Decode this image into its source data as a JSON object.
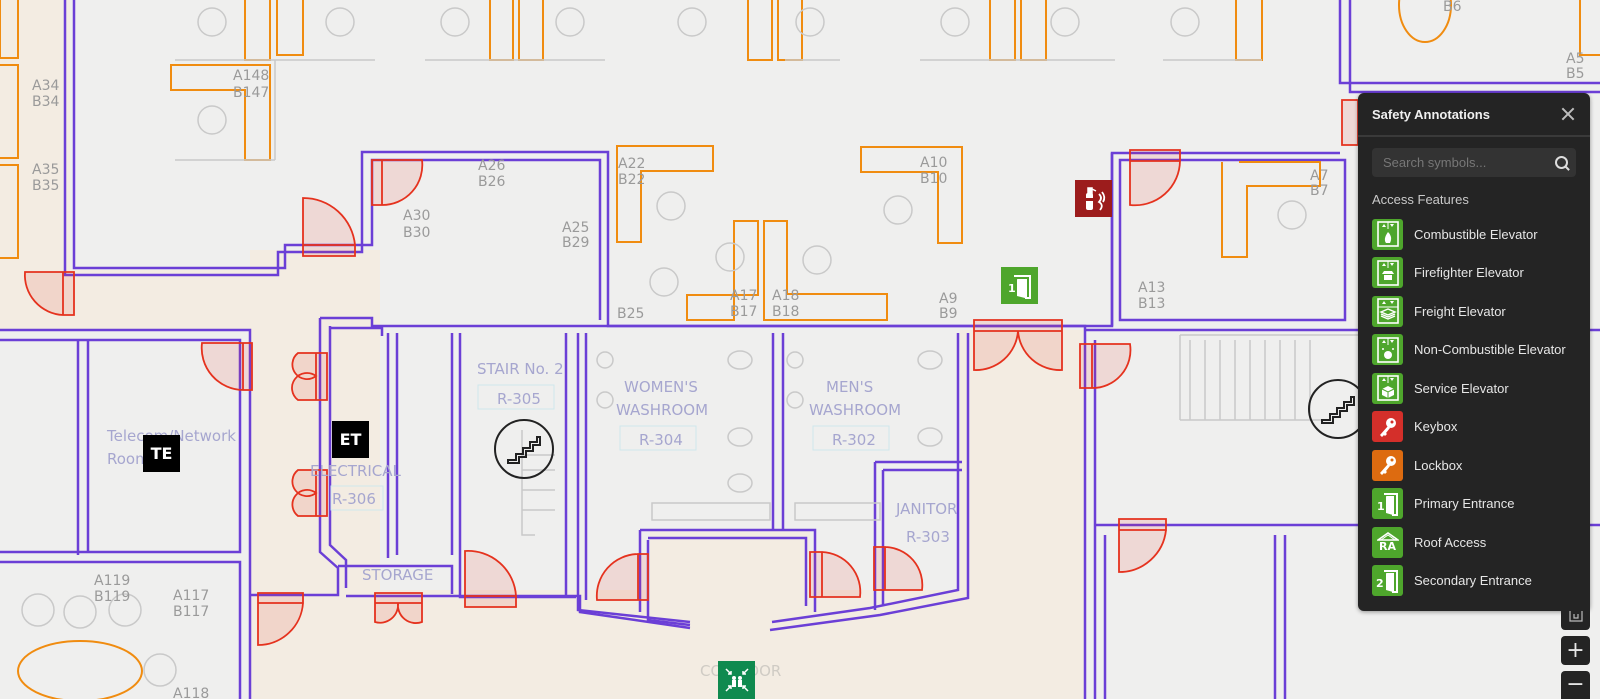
{
  "floor_plan": {
    "room_labels": [
      {
        "id": "a148",
        "lines": [
          "A148",
          "B147"
        ]
      },
      {
        "id": "a34",
        "lines": [
          "A34",
          "B34"
        ]
      },
      {
        "id": "a35",
        "lines": [
          "A35",
          "B35"
        ]
      },
      {
        "id": "a26",
        "lines": [
          "A26",
          "B26"
        ]
      },
      {
        "id": "a30",
        "lines": [
          "A30",
          "B30"
        ]
      },
      {
        "id": "a25",
        "lines": [
          "A25",
          "B29"
        ]
      },
      {
        "id": "a22",
        "lines": [
          "A22",
          "B22"
        ]
      },
      {
        "id": "a10",
        "lines": [
          "A10",
          "B10"
        ]
      },
      {
        "id": "a17",
        "lines": [
          "A17",
          "B17"
        ]
      },
      {
        "id": "a18",
        "lines": [
          "A18",
          "B18"
        ]
      },
      {
        "id": "b25",
        "lines": [
          "B25"
        ]
      },
      {
        "id": "a9",
        "lines": [
          "A9",
          "B9"
        ]
      },
      {
        "id": "a7",
        "lines": [
          "A7",
          "B7"
        ]
      },
      {
        "id": "a13",
        "lines": [
          "A13",
          "B13"
        ]
      },
      {
        "id": "b6",
        "lines": [
          "B6"
        ]
      },
      {
        "id": "a5",
        "lines": [
          "A5",
          "B5"
        ]
      },
      {
        "id": "a119",
        "lines": [
          "A119",
          "B119"
        ]
      },
      {
        "id": "a117",
        "lines": [
          "A117",
          "B117"
        ]
      },
      {
        "id": "a118",
        "lines": [
          "A118"
        ]
      }
    ],
    "named_rooms": {
      "telecom": [
        "Telecom/Network",
        "Room"
      ],
      "electrical": "ELECTRICAL",
      "electrical_code": "R-306",
      "storage": "STORAGE",
      "stair": "STAIR No. 2",
      "stair_code": "R-305",
      "womens": [
        "WOMEN'S",
        "WASHROOM"
      ],
      "womens_code": "R-304",
      "mens": [
        "MEN'S",
        "WASHROOM"
      ],
      "mens_code": "R-302",
      "janitor": "JANITOR",
      "janitor_code": "R-303",
      "corridor": "CORRIDOR"
    },
    "markers": {
      "te": "TE",
      "et": "ET",
      "fire_extinguisher": "fire-extinguisher-icon",
      "primary_entrance": "primary-entrance-icon",
      "assembly_point": "assembly-point-icon",
      "stairs": "stairs-icon"
    },
    "colors": {
      "wall": "#6b3fd6",
      "wall_fill": "#ddd3f3",
      "door": "#e5321e",
      "furniture": "#f08c10",
      "corridor": "#f3ece2",
      "room": "#efefee"
    }
  },
  "panel": {
    "title": "Safety Annotations",
    "search_placeholder": "Search symbols...",
    "search_value": "",
    "section_title": "Access Features",
    "items": [
      {
        "label": "Combustible Elevator",
        "icon": "combustible-elevator-icon",
        "color": "#4ea62c"
      },
      {
        "label": "Firefighter Elevator",
        "icon": "firefighter-elevator-icon",
        "color": "#4ea62c"
      },
      {
        "label": "Freight Elevator",
        "icon": "freight-elevator-icon",
        "color": "#4ea62c"
      },
      {
        "label": "Non-Combustible Elevator",
        "icon": "non-combustible-elevator-icon",
        "color": "#4ea62c"
      },
      {
        "label": "Service Elevator",
        "icon": "service-elevator-icon",
        "color": "#4ea62c"
      },
      {
        "label": "Keybox",
        "icon": "key-icon",
        "color": "#d42f2a"
      },
      {
        "label": "Lockbox",
        "icon": "key-icon",
        "color": "#dd6b10"
      },
      {
        "label": "Primary Entrance",
        "icon": "primary-entrance-icon",
        "color": "#4ea62c"
      },
      {
        "label": "Roof Access",
        "icon": "roof-access-icon",
        "color": "#4ea62c",
        "text": "RA"
      },
      {
        "label": "Secondary Entrance",
        "icon": "secondary-entrance-icon",
        "color": "#4ea62c"
      }
    ]
  },
  "map_controls": {
    "fit_label": "fit-to-screen",
    "zoom_in": "+",
    "zoom_out": "−"
  }
}
